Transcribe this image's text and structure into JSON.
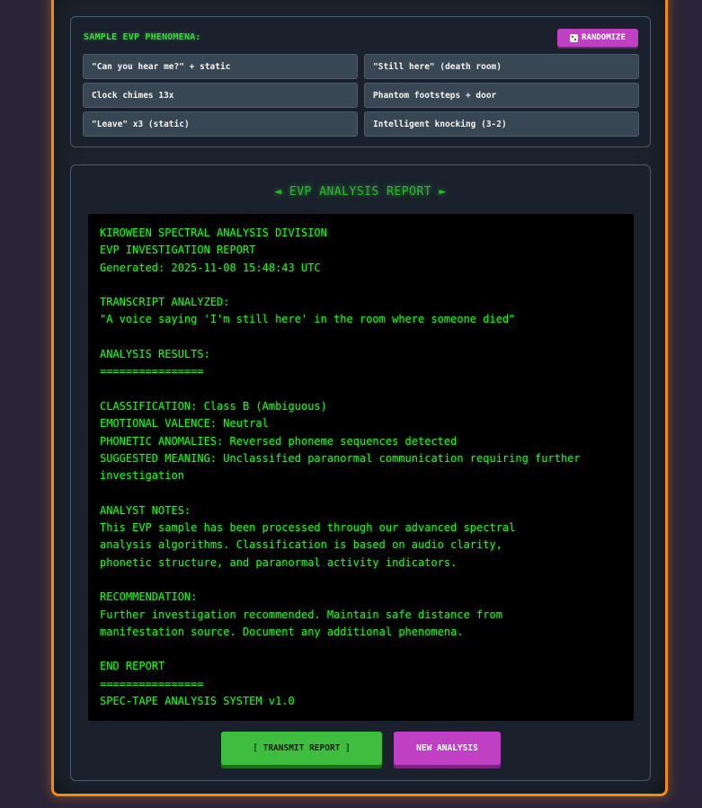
{
  "samples": {
    "header": "SAMPLE EVP PHENOMENA:",
    "randomize_label": "RANDOMIZE",
    "items": [
      "\"Can you hear me?\" + static",
      "\"Still here\" (death room)",
      "Clock chimes 13x",
      "Phantom footsteps + door",
      "\"Leave\" x3 (static)",
      "Intelligent knocking (3-2)"
    ]
  },
  "report": {
    "title": "◄ EVP ANALYSIS REPORT ►",
    "body": "KIROWEEN SPECTRAL ANALYSIS DIVISION\nEVP INVESTIGATION REPORT\nGenerated: 2025-11-08 15:48:43 UTC\n\nTRANSCRIPT ANALYZED:\n\"A voice saying 'I'm still here' in the room where someone died\"\n\nANALYSIS RESULTS:\n================\n\nCLASSIFICATION: Class B (Ambiguous)\nEMOTIONAL VALENCE: Neutral\nPHONETIC ANOMALIES: Reversed phoneme sequences detected\nSUGGESTED MEANING: Unclassified paranormal communication requiring further\ninvestigation\n\nANALYST NOTES:\nThis EVP sample has been processed through our advanced spectral\nanalysis algorithms. Classification is based on audio clarity,\nphonetic structure, and paranormal activity indicators.\n\nRECOMMENDATION:\nFurther investigation recommended. Maintain safe distance from\nmanifestation source. Document any additional phenomena.\n\nEND REPORT\n================\nSPEC-TAPE ANALYSIS SYSTEM v1.0",
    "transmit_label": "[ TRANSMIT REPORT ]",
    "new_analysis_label": "NEW ANALYSIS"
  },
  "colors": {
    "accent_orange": "#f08a12",
    "terminal_green": "#32e632",
    "button_magenta": "#c040c4",
    "button_green": "#3ebd3e"
  }
}
